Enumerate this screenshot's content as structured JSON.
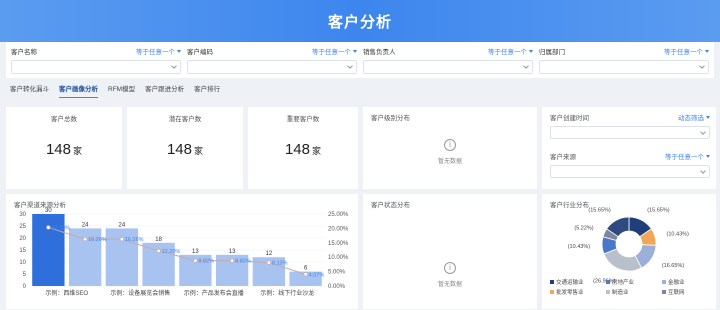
{
  "header": {
    "title": "客户分析"
  },
  "filters": [
    {
      "label": "客户名称",
      "any": "等于任意一个"
    },
    {
      "label": "客户编码",
      "any": "等于任意一个"
    },
    {
      "label": "销售负责人",
      "any": "等于任意一个"
    },
    {
      "label": "归属部门",
      "any": "等于任意一个"
    }
  ],
  "tabs": [
    {
      "label": "客户转化漏斗",
      "active": false
    },
    {
      "label": "客户画像分析",
      "active": true
    },
    {
      "label": "RFM模型",
      "active": false
    },
    {
      "label": "客户跟进分析",
      "active": false
    },
    {
      "label": "客户排行",
      "active": false
    }
  ],
  "kpis": [
    {
      "title": "客户总数",
      "value": "148",
      "unit": "家"
    },
    {
      "title": "潜在客户数",
      "value": "148",
      "unit": "家"
    },
    {
      "title": "重要客户数",
      "value": "148",
      "unit": "家"
    }
  ],
  "level_panel": {
    "title": "客户级别分布",
    "empty": "暂无数据"
  },
  "status_panel": {
    "title": "客户状态分布",
    "empty": "暂无数据"
  },
  "right_panel": {
    "created": {
      "label": "客户创建时间",
      "any": "动态筛选"
    },
    "source": {
      "label": "客户来源",
      "any": "等于任意一个"
    }
  },
  "channel_chart": {
    "title": "客户渠道来源分析"
  },
  "industry_chart": {
    "title": "客户行业分布",
    "labels": [
      "(15.65%)",
      "(5.22%)",
      "(10.43%)",
      "(26.96%)",
      "(10.43%)",
      "(10.43%)",
      "(16.65%)"
    ],
    "legend": [
      "交通运输业",
      "房地产业",
      "金融业",
      "批发零售业",
      "制造业",
      "互联网"
    ]
  },
  "chart_data": [
    {
      "type": "bar",
      "title": "客户渠道来源分析",
      "categories": [
        "示例：西维SEO",
        "",
        "示例：设备展览会销售",
        "",
        "示例：产品发布会直播",
        "",
        "示例：线下行业沙龙",
        ""
      ],
      "series": [
        {
          "type": "bar",
          "values": [
            30,
            24,
            24,
            18,
            13,
            13,
            12,
            6
          ]
        },
        {
          "type": "line",
          "values": [
            0.2033,
            0.1626,
            0.1626,
            0.122,
            0.0882,
            0.0882,
            0.0813,
            0.0407
          ],
          "labels": [
            "20.33%",
            "16.26%",
            "16.26%",
            "12.20%",
            "8.82%",
            "8.82%",
            "8.13%",
            "4.07%"
          ]
        }
      ],
      "ylim_left": [
        0,
        30
      ],
      "ylim_right": [
        0,
        0.25
      ],
      "yticks_left": [
        0,
        5,
        10,
        15,
        20,
        25,
        30
      ],
      "yticks_right": [
        "0.00%",
        "5.00%",
        "10.00%",
        "15.00%",
        "20.00%",
        "25.00%"
      ],
      "colors": {
        "bar_first": "#2f6fdc",
        "bar": "#a9c3f0",
        "line": "#c9a9a9"
      }
    },
    {
      "type": "pie",
      "title": "客户行业分布",
      "slices": [
        {
          "label": "(15.65%)",
          "value": 15.65,
          "color": "#1f3e7a"
        },
        {
          "label": "(10.43%)",
          "value": 10.43,
          "color": "#f2a65a"
        },
        {
          "label": "(16.65%)",
          "value": 16.65,
          "color": "#9ab0d8"
        },
        {
          "label": "(26.96%)",
          "value": 26.96,
          "color": "#b8c0cc"
        },
        {
          "label": "(10.43%)",
          "value": 10.43,
          "color": "#4a77c8"
        },
        {
          "label": "(5.22%)",
          "value": 5.22,
          "color": "#7b86a0"
        },
        {
          "label": "(15.65%)",
          "value": 15.65,
          "color": "#2f4a80"
        }
      ],
      "donut": true
    }
  ]
}
